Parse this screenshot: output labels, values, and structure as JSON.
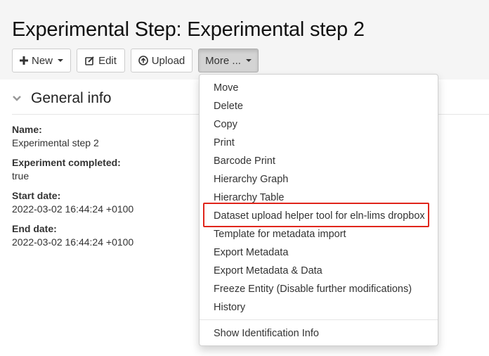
{
  "header": {
    "title": "Experimental Step: Experimental step 2"
  },
  "toolbar": {
    "new_label": "New",
    "edit_label": "Edit",
    "upload_label": "Upload",
    "more_label": "More ..."
  },
  "section": {
    "title": "General info"
  },
  "fields": [
    {
      "label": "Name:",
      "value": "Experimental step 2"
    },
    {
      "label": "Experiment completed:",
      "value": "true"
    },
    {
      "label": "Start date:",
      "value": "2022-03-02 16:44:24 +0100"
    },
    {
      "label": "End date:",
      "value": "2022-03-02 16:44:24 +0100"
    }
  ],
  "more_menu": {
    "items": [
      "Move",
      "Delete",
      "Copy",
      "Print",
      "Barcode Print",
      "Hierarchy Graph",
      "Hierarchy Table",
      "Dataset upload helper tool for eln-lims dropbox",
      "Template for metadata import",
      "Export Metadata",
      "Export Metadata & Data",
      "Freeze Entity (Disable further modifications)",
      "History"
    ],
    "footer_item": "Show Identification Info",
    "highlighted_item": "Dataset upload helper tool for eln-lims dropbox"
  },
  "colors": {
    "highlight": "#e0251b",
    "header_band": "#f5f5f5",
    "active_button": "#d4d4d4"
  },
  "icons": {
    "new": "plus-icon",
    "edit": "edit-icon",
    "upload": "upload-icon",
    "section": "chevron-down-icon"
  }
}
